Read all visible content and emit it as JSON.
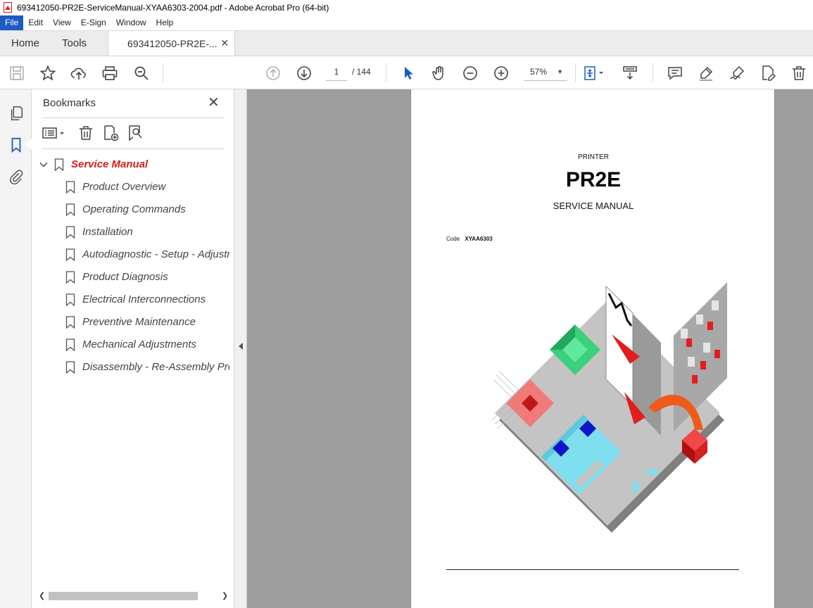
{
  "window": {
    "title": "693412050-PR2E-ServiceManual-XYAA6303-2004.pdf - Adobe Acrobat Pro (64-bit)"
  },
  "menu": {
    "items": [
      "File",
      "Edit",
      "View",
      "E-Sign",
      "Window",
      "Help"
    ]
  },
  "tabs": {
    "home": "Home",
    "tools": "Tools",
    "document": "693412050-PR2E-...",
    "close_glyph": "✕"
  },
  "toolbar": {
    "page_current": "1",
    "page_total": "/ 144",
    "zoom": "57%",
    "icons": [
      "save-icon",
      "star-icon",
      "upload-icon",
      "print-icon",
      "zoom-search-icon",
      "page-up-icon",
      "page-down-icon",
      "select-arrow-icon",
      "hand-icon",
      "zoom-out-icon",
      "zoom-in-icon",
      "fit-page-icon",
      "scroll-mode-icon",
      "comment-icon",
      "highlight-pen-icon",
      "sign-icon",
      "edit-pdf-icon",
      "delete-icon"
    ]
  },
  "bookmarks": {
    "header": "Bookmarks",
    "close_glyph": "✕",
    "items": [
      {
        "label": "Service Manual",
        "level": 0
      },
      {
        "label": "Product Overview",
        "level": 1
      },
      {
        "label": "Operating Commands",
        "level": 1
      },
      {
        "label": "Installation",
        "level": 1
      },
      {
        "label": "Autodiagnostic - Setup - Adjustm",
        "level": 1
      },
      {
        "label": "Product Diagnosis",
        "level": 1
      },
      {
        "label": "Electrical Interconnections",
        "level": 1
      },
      {
        "label": "Preventive Maintenance",
        "level": 1
      },
      {
        "label": "Mechanical Adjustments",
        "level": 1
      },
      {
        "label": "Disassembly - Re-Assembly Proc",
        "level": 1
      }
    ]
  },
  "document": {
    "kicker": "PRINTER",
    "model": "PR2E",
    "subtitle": "SERVICE MANUAL",
    "code_label": "Code",
    "code_value": "XYAA6303"
  },
  "colors": {
    "accent_blue": "#1c5bbf",
    "bookmark_top": "#d71e1e",
    "doc_background": "#9e9e9e"
  }
}
